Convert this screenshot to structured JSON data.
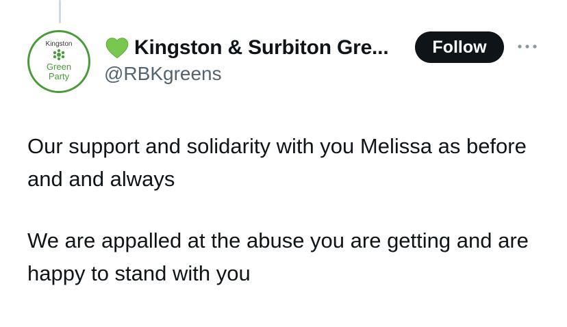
{
  "author": {
    "display_name": "Kingston & Surbiton Gre...",
    "handle": "@RBKgreens",
    "avatar": {
      "top_text": "Kingston",
      "line1": "Green",
      "line2": "Party"
    },
    "badge_icon": "green-heart-icon"
  },
  "actions": {
    "follow_label": "Follow",
    "more_icon": "more-horizontal-icon"
  },
  "tweet": {
    "paragraphs": [
      "Our support and solidarity with you Melissa as before and and always",
      "We are appalled at the abuse you are getting and are happy to stand with you"
    ]
  },
  "colors": {
    "brand_green": "#4a9a3a",
    "heart_green": "#78c850",
    "follow_bg": "#0f1419",
    "muted_text": "#536471"
  }
}
